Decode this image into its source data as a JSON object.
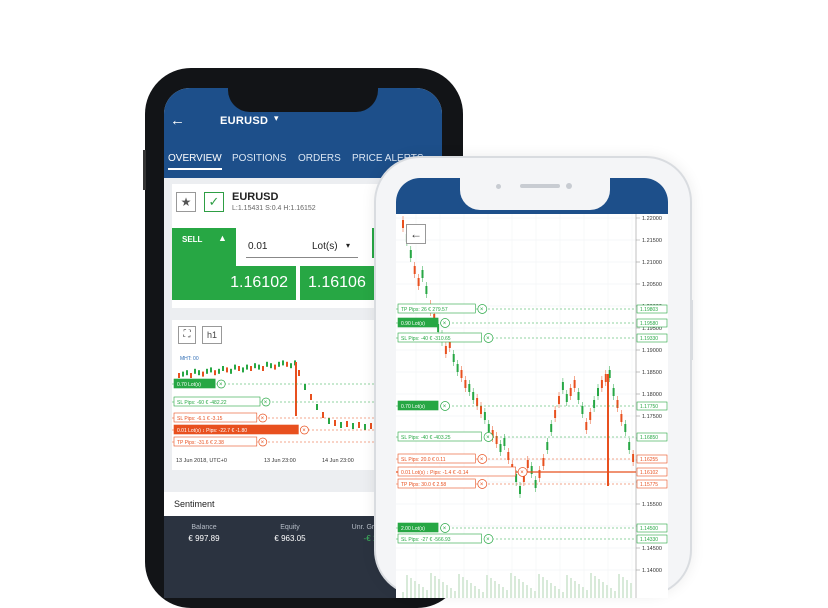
{
  "phone_back": {
    "header": {
      "back_icon": "arrow-left-icon",
      "symbol": "EURUSD",
      "dropdown_icon": "caret-down-icon"
    },
    "tabs": [
      {
        "label": "OVERVIEW",
        "active": true
      },
      {
        "label": "POSITIONS",
        "active": false
      },
      {
        "label": "ORDERS",
        "active": false
      },
      {
        "label": "PRICE ALERTS",
        "active": false
      }
    ],
    "instrument": {
      "symbol": "EURUSD",
      "stats": "L:1.15431  S:0.4  H:1.16152",
      "sell_label": "SELL",
      "quantity": "0.01",
      "unit": "Lot(s)",
      "sell_price": "1.16102",
      "buy_price": "1.16106"
    },
    "chart": {
      "timeframe": "h1",
      "orders": [
        {
          "text": "0.70 Lot(s)",
          "color": "#27a744"
        },
        {
          "text": "SL  Pips: -60   € -482.22",
          "color": "#27a744"
        },
        {
          "text": "SL  Pips: -6.1   € -3.15",
          "color": "#e8501f"
        },
        {
          "text": "0.01 Lot(s)  ↕  Pips: -22.7   € -1.80",
          "color": "#e8501f"
        },
        {
          "text": "TP  Pips: -31.6   € 2.38",
          "color": "#e8501f"
        }
      ],
      "x_labels": [
        "13 Jun 2018, UTC+0",
        "13 Jun 23:00",
        "14 Jun 23:00"
      ],
      "top_label": "MHT: 00"
    },
    "sentiment_title": "Sentiment",
    "account": [
      {
        "label": "Balance",
        "value": "€ 997.89"
      },
      {
        "label": "Equity",
        "value": "€ 963.05"
      },
      {
        "label": "Unr. Gross P&L",
        "value": "-€ 1.40"
      }
    ]
  },
  "phone_front": {
    "back_icon": "arrow-left-icon",
    "price_ticks": [
      "1.22000",
      "1.21500",
      "1.21000",
      "1.20500",
      "1.20000",
      "1.19500",
      "1.19000",
      "1.18500",
      "1.18000",
      "1.17500",
      "1.17000",
      "1.16500",
      "1.16000",
      "1.15500",
      "1.15000",
      "1.14500",
      "1.14000"
    ],
    "orders": [
      {
        "text": "TP  Pips: 26   € 279.57",
        "price": "1.19803",
        "color": "#27a744"
      },
      {
        "text": "0.90 Lot(s)",
        "price": "1.19580",
        "color": "#27a744"
      },
      {
        "text": "SL  Pips: -40   € -310.65",
        "price": "1.19330",
        "color": "#27a744"
      },
      {
        "text": "0.70 Lot(s)",
        "price": "1.17750",
        "color": "#27a744"
      },
      {
        "text": "SL  Pips: -40   € -403.25",
        "price": "1.16850",
        "color": "#27a744"
      },
      {
        "text": "SL  Pips: 20.0   € 0.11",
        "price": "1.16255",
        "color": "#e8501f"
      },
      {
        "text": "0.01 Lot(s)  ↕  Pips: -1.4   € -0.14",
        "price": "1.16102",
        "color": "#e8501f"
      },
      {
        "text": "TP  Pips: 30.0   € 2.58",
        "price": "1.15775",
        "color": "#e8501f"
      },
      {
        "text": "2.00 Lot(s)",
        "price": "1.14500",
        "color": "#27a744"
      },
      {
        "text": "SL  Pips: -27   € -566.93",
        "price": "1.14330",
        "color": "#27a744"
      }
    ]
  },
  "colors": {
    "brand": "#1d4f8a",
    "buy": "#27a744",
    "sell": "#e8501f",
    "dark": "#2b3340"
  }
}
